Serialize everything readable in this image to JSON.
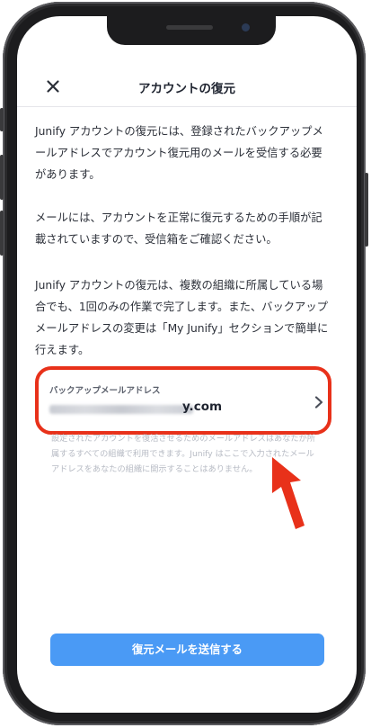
{
  "header": {
    "title": "アカウントの復元",
    "close_icon": "close-icon"
  },
  "content": {
    "paragraph1": "Junify アカウントの復元には、登録されたバックアップメールアドレスでアカウント復元用のメールを受信する必要があります。",
    "paragraph2": "メールには、アカウントを正常に復元するための手順が記載されていますので、受信箱をご確認ください。",
    "paragraph3": "Junify アカウントの復元は、複数の組織に所属している場合でも、1回のみの作業で完了します。また、バックアップメールアドレスの変更は「My Junify」セクションで簡単に行えます。"
  },
  "backup_email": {
    "label": "バックアップメールアドレス",
    "value_visible_suffix": "y.com",
    "chevron_icon": "chevron-right-icon"
  },
  "help_text": "設定されたアカウントを復活させるためのメールアドレスはあなたが所属するすべての組織で利用できます。Junify はここで入力されたメールアドレスをあなたの組織に開示することはありません。",
  "actions": {
    "send_label": "復元メールを送信する"
  },
  "colors": {
    "accent": "#4a9af5",
    "highlight": "#e8311a"
  }
}
